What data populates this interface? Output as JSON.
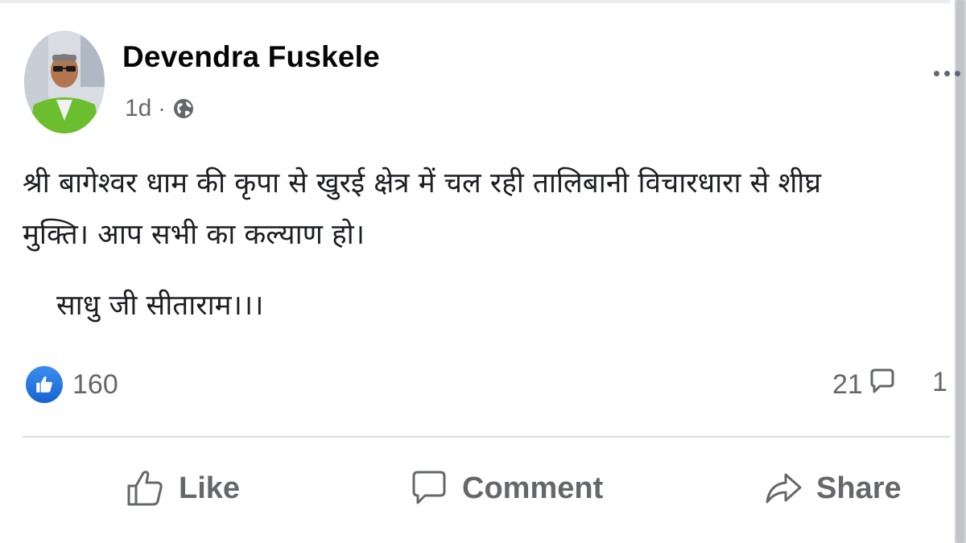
{
  "post": {
    "author": "Devendra Fuskele",
    "timestamp": "1d",
    "separator": "·",
    "audience_icon": "globe-icon",
    "more_icon": "more-options-icon",
    "text_line1": "श्री बागेश्वर धाम की कृपा से खुरई क्षेत्र में चल रही  तालिबानी विचारधारा से शीघ्र",
    "text_line2": "मुक्ति। आप सभी का कल्याण हो।",
    "signature": "साधु जी सीताराम।।।"
  },
  "stats": {
    "reaction_icon": "like-reaction-icon",
    "reactions": "160",
    "comments": "21",
    "comment_icon": "comment-bubble-icon",
    "shares": "1"
  },
  "actions": {
    "like": "Like",
    "comment": "Comment",
    "share": "Share"
  },
  "colors": {
    "like_blue": "#1877f2",
    "muted_text": "#65676b",
    "divider": "#dadde1"
  }
}
